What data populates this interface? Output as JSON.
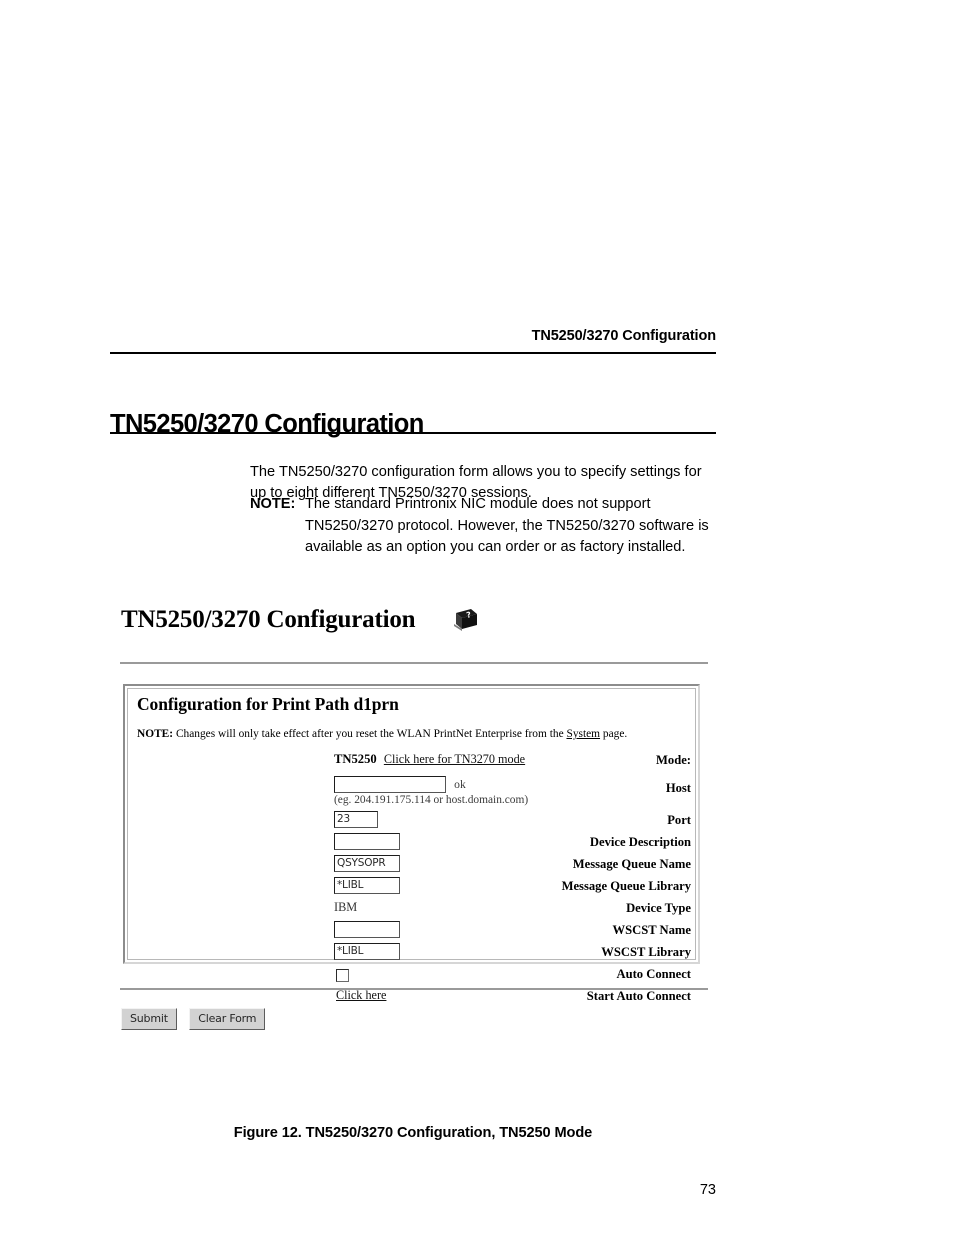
{
  "running_header": "TN5250/3270 Configuration",
  "page_title": "TN5250/3270 Configuration",
  "body_paragraph": "The TN5250/3270 configuration form allows you to specify settings for up to eight different TN5250/3270 sessions.",
  "note": {
    "label": "NOTE:",
    "text": "The standard Printronix NIC module does not support TN5250/3270 protocol. However, the TN5250/3270 software is available as an option you can order or as factory installed."
  },
  "figure": {
    "header_title": "TN5250/3270 Configuration",
    "help_icon": "help-book-icon",
    "form_heading": "Configuration for Print Path d1prn",
    "form_note": {
      "label": "NOTE:",
      "text_before": "Changes will only take effect after you reset the WLAN PrintNet Enterprise from the",
      "link": "System",
      "text_after": "page."
    },
    "rows": [
      {
        "label": "Mode:",
        "value": "TN5250",
        "link": "Click here for TN3270 mode",
        "kind": "mode"
      },
      {
        "label": "Host",
        "value": "",
        "side_note": "ok",
        "hint": "(eg. 204.191.175.114 or host.domain.com)",
        "kind": "text-host"
      },
      {
        "label": "Port",
        "value": "23",
        "kind": "text-port"
      },
      {
        "label": "Device Description",
        "value": "",
        "kind": "text-std"
      },
      {
        "label": "Message Queue Name",
        "value": "QSYSOPR",
        "kind": "text-std"
      },
      {
        "label": "Message Queue Library",
        "value": "*LIBL",
        "kind": "text-std"
      },
      {
        "label": "Device Type",
        "value": "IBM",
        "kind": "plain"
      },
      {
        "label": "WSCST Name",
        "value": "",
        "kind": "text-std"
      },
      {
        "label": "WSCST Library",
        "value": "*LIBL",
        "kind": "text-std"
      },
      {
        "label": "Auto Connect",
        "checked": false,
        "kind": "checkbox"
      },
      {
        "label": "Start Auto Connect",
        "link": "Click here",
        "kind": "link"
      }
    ],
    "buttons": {
      "submit": "Submit",
      "clear": "Clear Form"
    }
  },
  "figure_caption": "Figure 12. TN5250/3270 Configuration, TN5250 Mode",
  "page_number": "73"
}
